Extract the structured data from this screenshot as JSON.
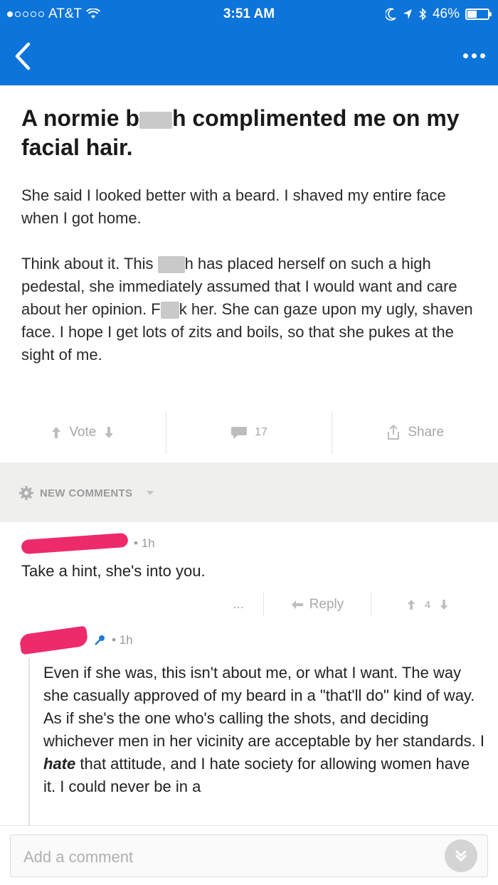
{
  "status_bar": {
    "carrier": "AT&T",
    "time": "3:51 AM",
    "battery": "46%",
    "battery_level": 0.46
  },
  "post": {
    "title_parts": [
      "A normie b",
      "h complimented me on my facial hair."
    ],
    "paragraph1": "She said I looked better with a beard. I shaved my entire face when I got home.",
    "paragraph2": {
      "a": "Think about it. This ",
      "b": "h has placed herself on such a high pedestal, she immediately assumed that I would want and care about her opinion. F",
      "c": "k her. She can gaze upon my ugly, shaven face. I hope I get lots of zits and boils, so that she  pukes at the sight of me."
    }
  },
  "actions": {
    "vote_label": "Vote",
    "comment_count": "17",
    "share_label": "Share"
  },
  "new_comments": {
    "label": "NEW COMMENTS"
  },
  "comment1": {
    "time": "1h",
    "text": "Take a hint, she's into you.",
    "more": "...",
    "reply_label": "Reply",
    "score": "4"
  },
  "comment2": {
    "time": "1h",
    "text_a": "Even if she was, this isn't about me, or what I want. The way she casually approved of my beard in a \"that'll do\" kind of way. As if she's the one who's calling the shots, and deciding whichever men in her vicinity are acceptable by her standards. I ",
    "text_em": "hate",
    "text_b": " that attitude, and I hate society for allowing women have it. I could never be in a"
  },
  "composer": {
    "placeholder": "Add a comment"
  },
  "colors": {
    "nav_blue": "#0d74d9",
    "redact_pink": "#ed2a6a"
  }
}
